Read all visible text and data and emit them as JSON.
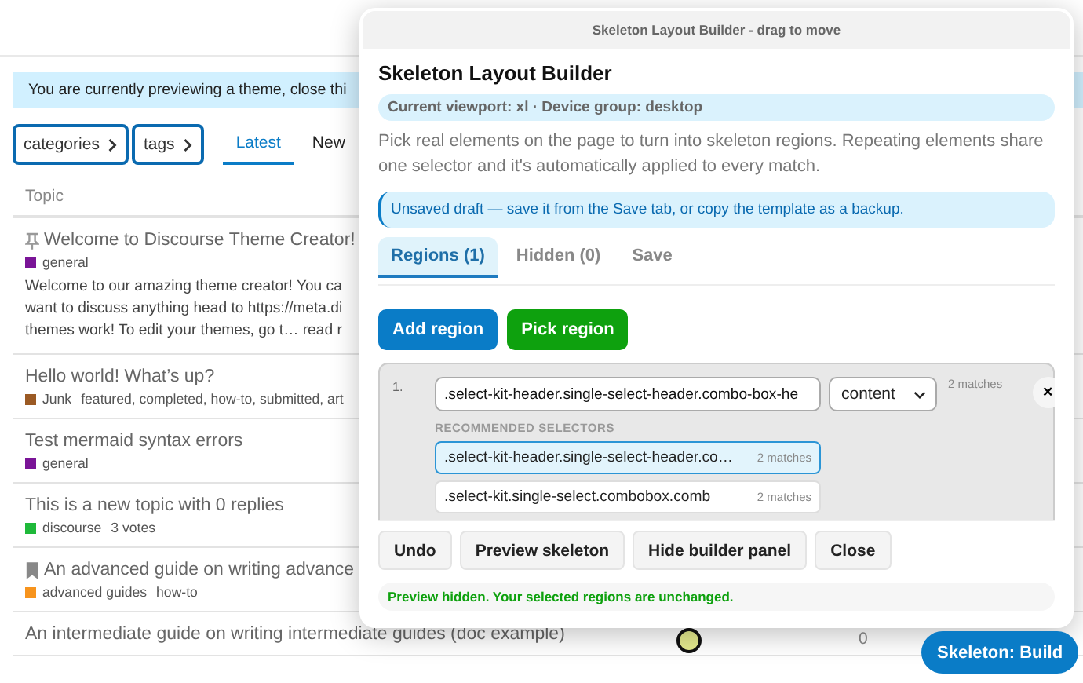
{
  "site": {
    "banner": "You are currently previewing a theme, close thi",
    "filters": [
      {
        "label": "categories"
      },
      {
        "label": "tags"
      }
    ],
    "nav": [
      {
        "label": "Latest",
        "selected": true
      },
      {
        "label": "New",
        "selected": false
      }
    ],
    "column_header": "Topic",
    "topics": [
      {
        "kind": "pinned",
        "title": "Welcome to Discourse Theme Creator!",
        "category": "general",
        "color": "#7a1497",
        "excerpt": [
          "Welcome to our amazing theme creator! You ca",
          "want to discuss anything head to https://meta.di",
          "themes work! To edit your themes, go t… read r"
        ]
      },
      {
        "kind": "plain",
        "title": "Hello world! What’s up?",
        "category": "Junk",
        "color": "#9b5a24",
        "tags": "featured, completed, how-to, submitted, art"
      },
      {
        "kind": "plain",
        "title": "Test mermaid syntax errors",
        "category": "general",
        "color": "#7a1497"
      },
      {
        "kind": "plain",
        "title": "This is a new topic with 0 replies",
        "category": "discourse",
        "color": "#1fb93a",
        "tags": "3 votes"
      },
      {
        "kind": "bookmarked",
        "title": "An advanced guide on writing advance",
        "category": "advanced guides",
        "color": "#f7941d",
        "tags": "how-to"
      },
      {
        "kind": "plain",
        "title": "An intermediate guide on writing intermediate guides (doc example)",
        "replies": "0"
      }
    ]
  },
  "panel": {
    "titlebar": "Skeleton Layout Builder - drag to move",
    "title": "Skeleton Layout Builder",
    "viewport_info": "Current viewport: xl · Device group: desktop",
    "description": "Pick real elements on the page to turn into skeleton regions. Repeating elements share one selector and it's automatically applied to every match.",
    "draft_notice": "Unsaved draft — save it from the Save tab, or copy the template as a backup.",
    "tabs": [
      {
        "label": "Regions (1)",
        "selected": true
      },
      {
        "label": "Hidden (0)",
        "selected": false
      },
      {
        "label": "Save",
        "selected": false
      }
    ],
    "actions": [
      {
        "label": "Add region",
        "kind": "primary"
      },
      {
        "label": "Pick region",
        "kind": "success"
      }
    ],
    "regions": [
      {
        "number": "1.",
        "selector": ".select-kit-header.single-select-header.combo-box-he",
        "type": "content",
        "matches": "2 matches",
        "remove": "×"
      }
    ],
    "recommended_heading": "RECOMMENDED SELECTORS",
    "recommended": [
      {
        "selector": ".select-kit-header.single-select-header.co…",
        "matches": "2 matches",
        "selected": true
      },
      {
        "selector": ".select-kit.single-select.combobox.comb",
        "matches": "2 matches",
        "selected": false
      }
    ],
    "footer_buttons": [
      "Undo",
      "Preview skeleton",
      "Hide builder panel",
      "Close"
    ],
    "status": "Preview hidden. Your selected regions are unchanged."
  },
  "launcher": "Skeleton: Build"
}
